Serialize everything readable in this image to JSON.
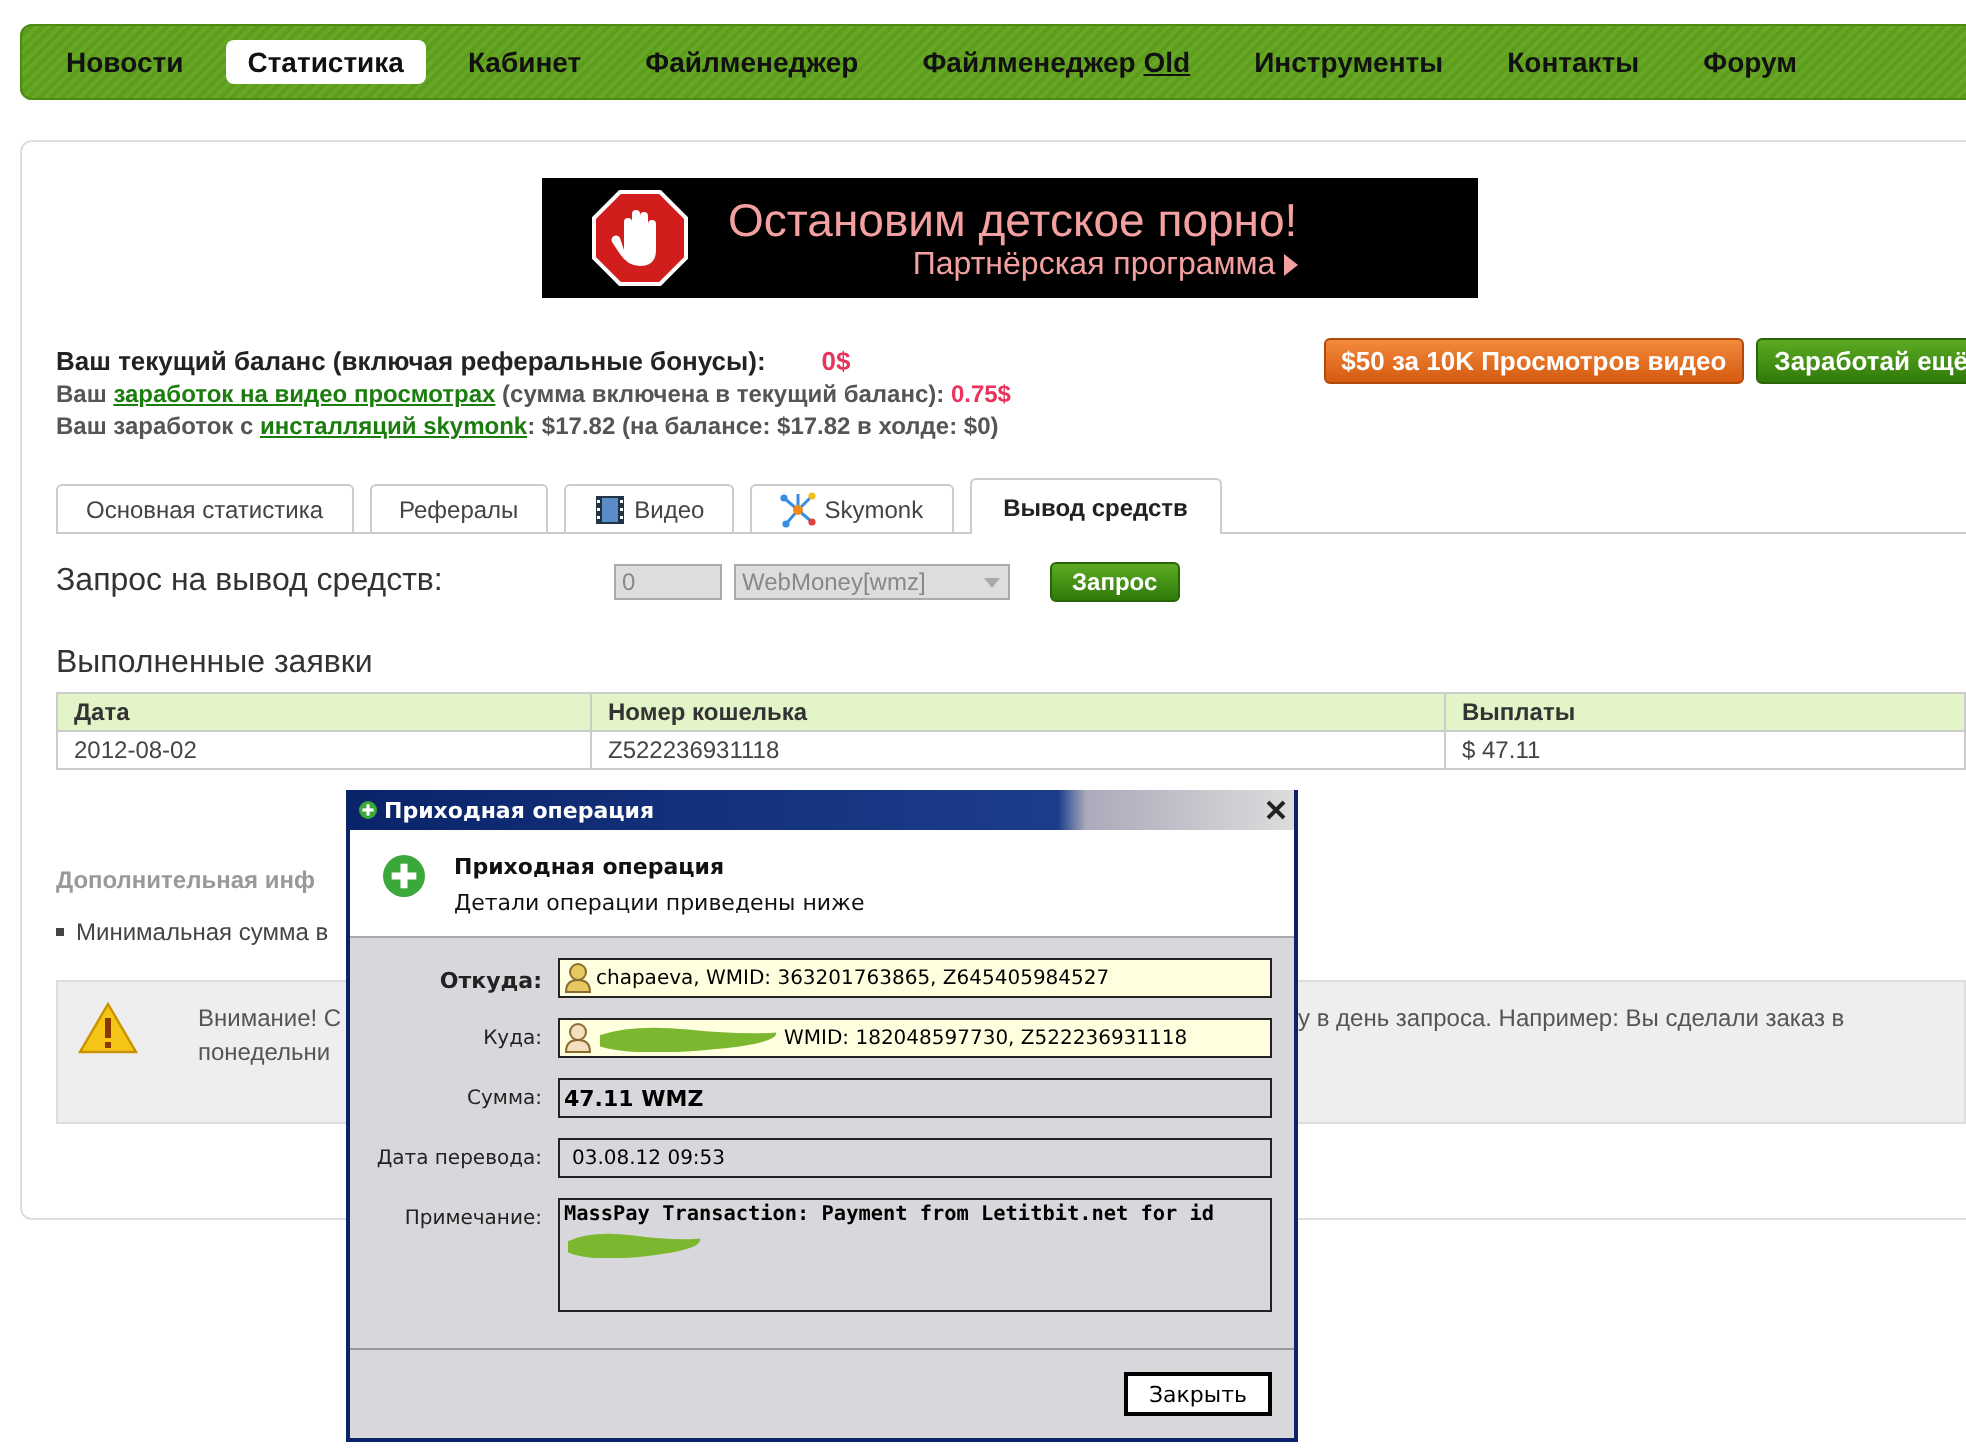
{
  "nav": [
    {
      "label": "Новости",
      "selected": false
    },
    {
      "label": "Статистика",
      "selected": true
    },
    {
      "label": "Кабинет",
      "selected": false
    },
    {
      "label": "Файлменеджер",
      "selected": false
    },
    {
      "label": "Файлменеджер",
      "suffix": "Old",
      "selected": false
    },
    {
      "label": "Инструменты",
      "selected": false
    },
    {
      "label": "Контакты",
      "selected": false
    },
    {
      "label": "Форум",
      "selected": false
    }
  ],
  "banner": {
    "headline": "Остановим детское порно!",
    "subline": "Партнёрская программа"
  },
  "balance": {
    "label": "Ваш текущий баланс (включая реферальные бонусы):",
    "value": "0$"
  },
  "promo_buttons": [
    {
      "label": "$50 за 10K Просмотров видео",
      "kind": "orange"
    },
    {
      "label": "Заработай ещё",
      "kind": "green"
    }
  ],
  "earnings": [
    {
      "prefix": "Ваш",
      "link": "заработок на видео просмотрах",
      "rest": "(сумма включена в текущий баланс):",
      "amount": "0.75$"
    },
    {
      "prefix": "Ваш заработок с",
      "link": "инсталляций skymonk",
      "rest": ": $17.82 (на балансе: $17.82 в холде: $0)"
    }
  ],
  "tabs": [
    {
      "label": "Основная статистика",
      "kind": "plain",
      "selected": false
    },
    {
      "label": "Рефералы",
      "kind": "plain",
      "selected": false
    },
    {
      "label": "Видео",
      "kind": "video",
      "selected": false
    },
    {
      "label": "Skymonk",
      "kind": "skymonk",
      "selected": false
    },
    {
      "label": "Вывод средств",
      "kind": "plain",
      "selected": true
    }
  ],
  "withdraw": {
    "label": "Запрос на вывод средств:",
    "amount": "0",
    "currency": "WebMoney[wmz]",
    "disabled": true,
    "button": "Запрос"
  },
  "completed": {
    "title": "Выполненные заявки",
    "columns": [
      "Дата",
      "Номер кошелька",
      "Выплаты"
    ],
    "rows": [
      [
        "2012-08-02",
        "Z522236931118",
        "$ 47.11"
      ]
    ]
  },
  "info": {
    "heading": "Дополнительная инф",
    "bullets": [
      "Минимальная сумма в"
    ]
  },
  "warning": {
    "left_lines": [
      "Внимание! С",
      "понедельни"
    ],
    "right_text": "у в день запроса. Например: Вы сделали заказ в"
  },
  "dialog": {
    "title": "Приходная операция",
    "header_title": "Приходная операция",
    "header_subtitle": "Детали операции приведены ниже",
    "fields": [
      {
        "label": "Откуда:",
        "value": "chapaeva, WMID: 363201763865, Z645405984527",
        "kind": "sender"
      },
      {
        "label": "Куда:",
        "value": "WMID: 182048597730, Z522236931118",
        "kind": "recipient"
      },
      {
        "label": "Сумма:",
        "value": "47.11 WMZ",
        "kind": "amount"
      },
      {
        "label": "Дата перевода:",
        "value": "03.08.12 09:53",
        "kind": "date"
      },
      {
        "label": "Примечание:",
        "value": "MassPay Transaction: Payment from Letitbit.net for id",
        "kind": "note"
      }
    ],
    "close_button": "Закрыть"
  }
}
